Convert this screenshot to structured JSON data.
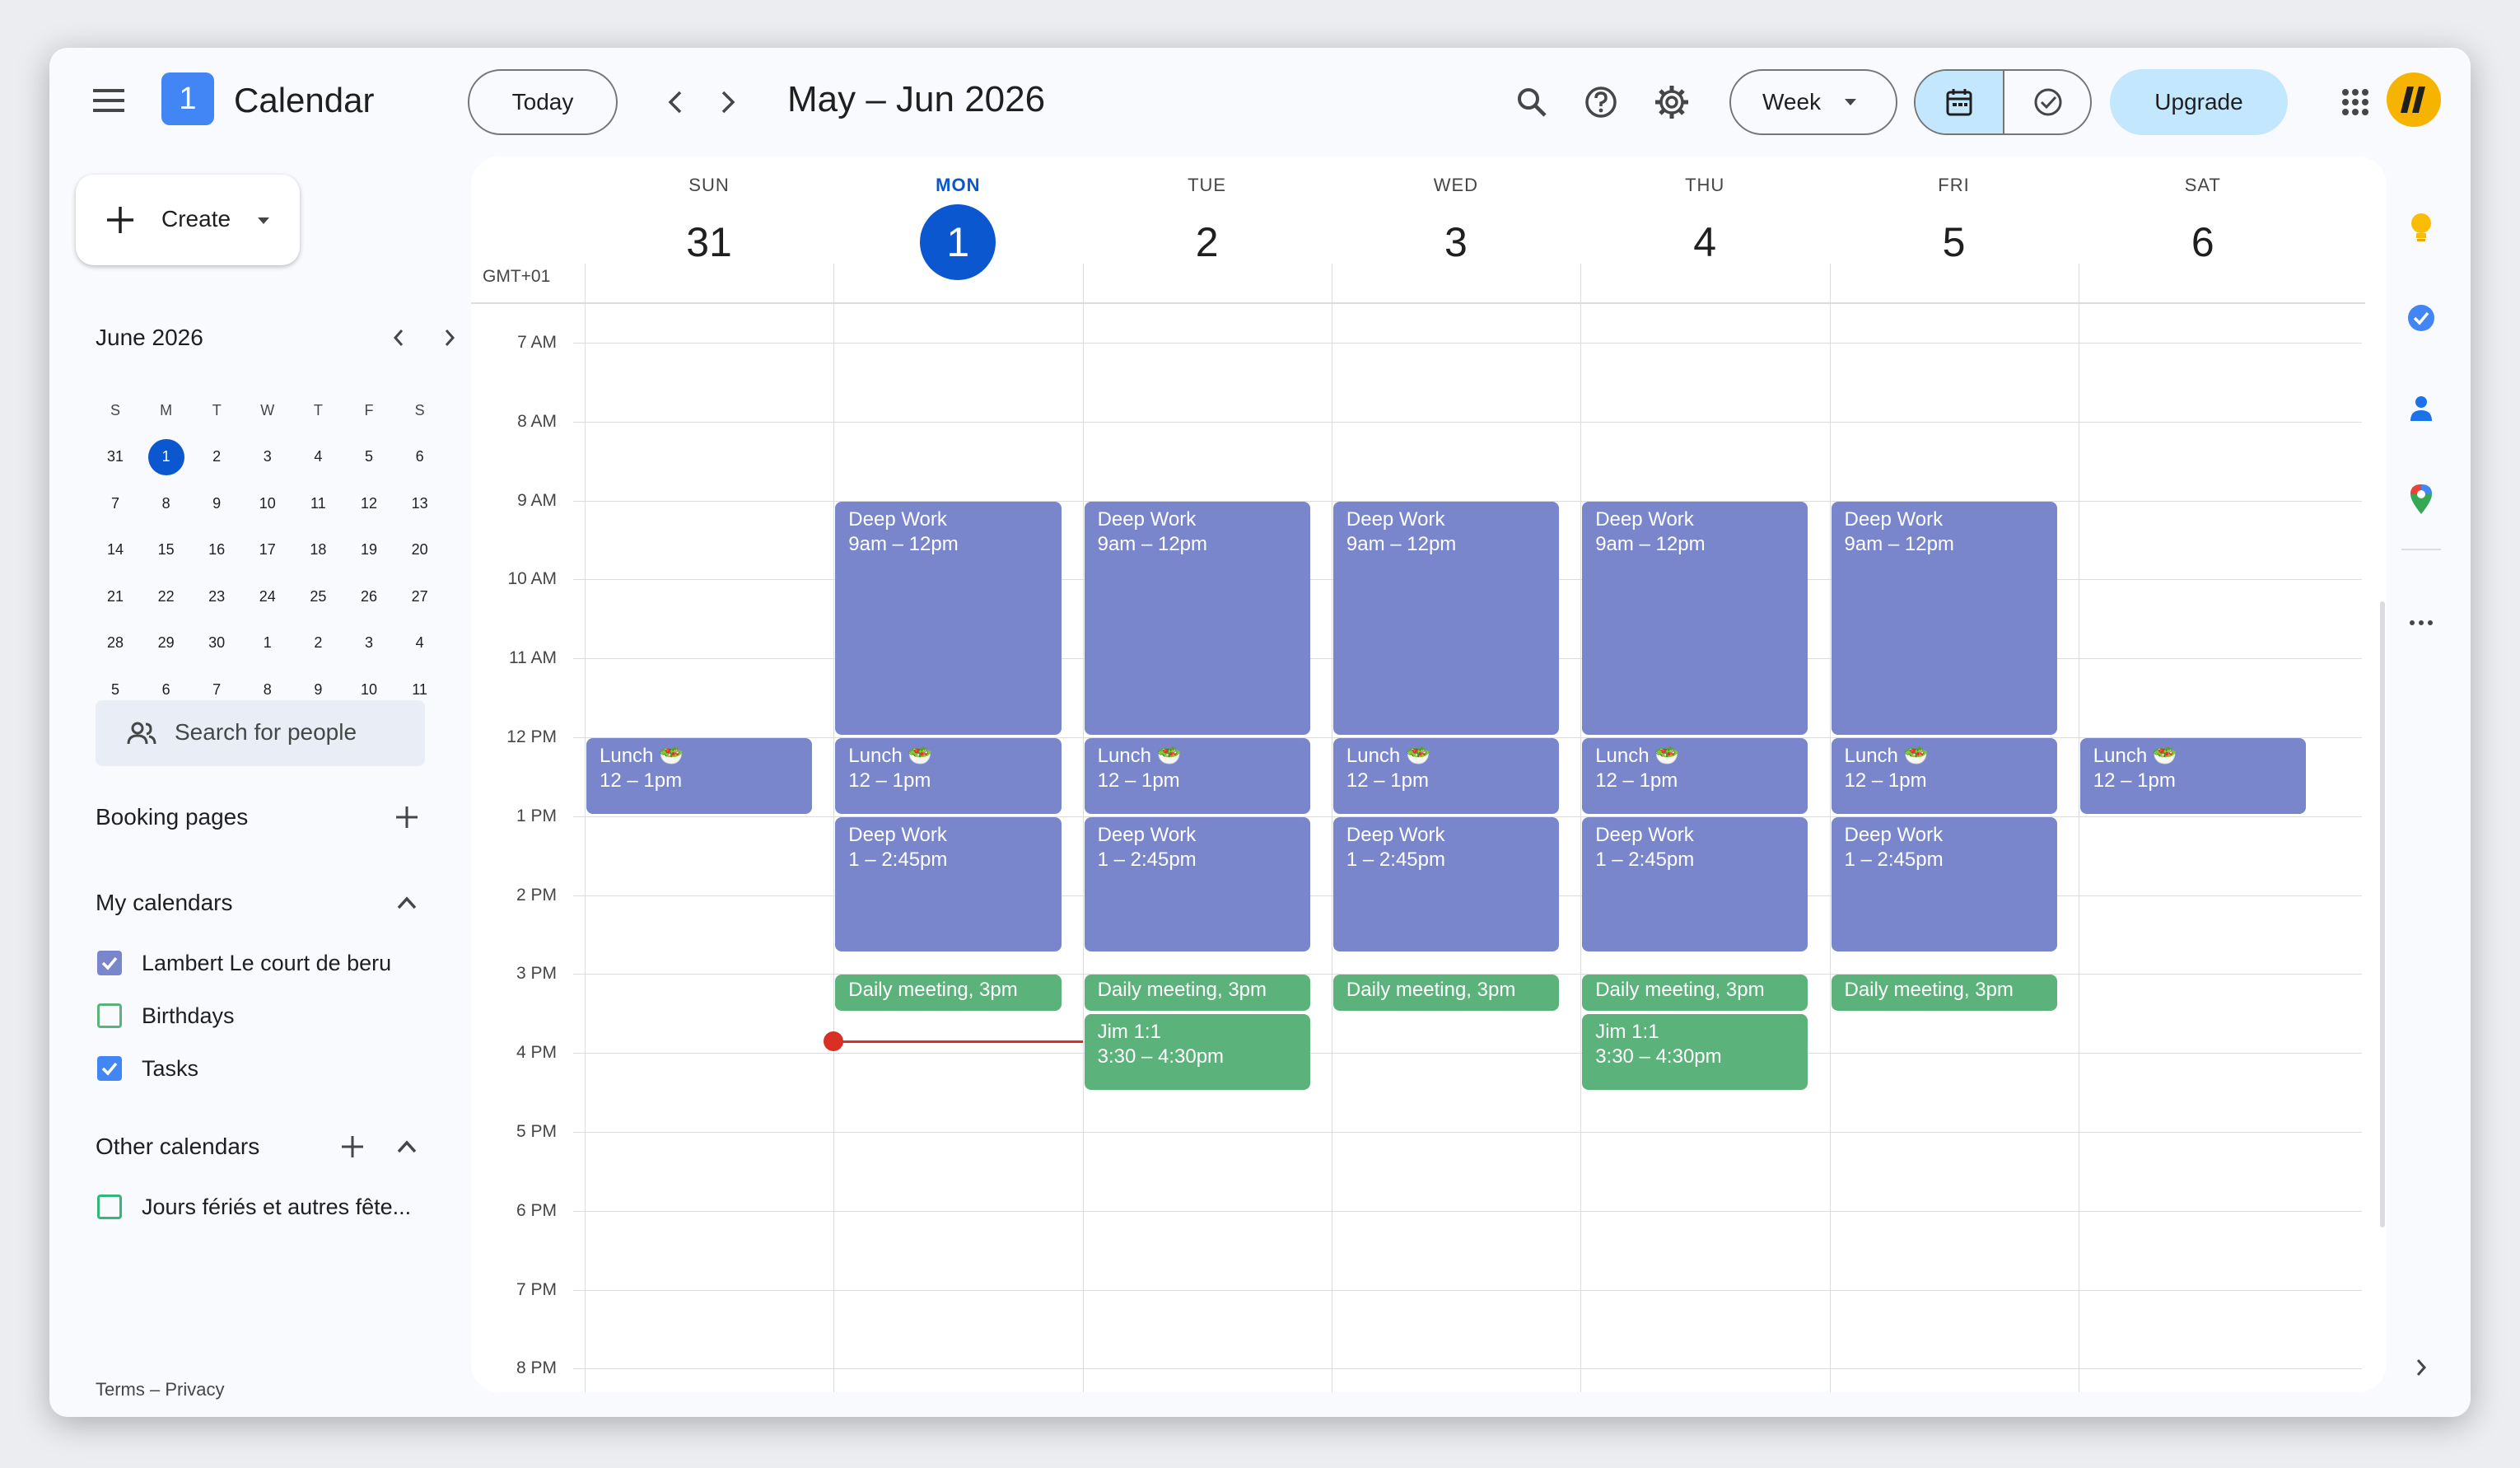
{
  "header": {
    "app_title": "Calendar",
    "logo_day": "1",
    "today_button": "Today",
    "date_range": "May – Jun 2026",
    "view_selector": "Week",
    "upgrade_button": "Upgrade"
  },
  "sidebar": {
    "create_button": "Create",
    "mini_calendar": {
      "month_label": "June 2026",
      "weekday_headers": [
        "S",
        "M",
        "T",
        "W",
        "T",
        "F",
        "S"
      ],
      "weeks": [
        [
          "31",
          "1",
          "2",
          "3",
          "4",
          "5",
          "6"
        ],
        [
          "7",
          "8",
          "9",
          "10",
          "11",
          "12",
          "13"
        ],
        [
          "14",
          "15",
          "16",
          "17",
          "18",
          "19",
          "20"
        ],
        [
          "21",
          "22",
          "23",
          "24",
          "25",
          "26",
          "27"
        ],
        [
          "28",
          "29",
          "30",
          "1",
          "2",
          "3",
          "4"
        ],
        [
          "5",
          "6",
          "7",
          "8",
          "9",
          "10",
          "11"
        ]
      ],
      "selected": "1"
    },
    "search_people_placeholder": "Search for people",
    "booking_pages_label": "Booking pages",
    "my_calendars_label": "My calendars",
    "my_calendars": [
      {
        "name": "Lambert Le court de beru",
        "checked": true,
        "color": "#7986cb"
      },
      {
        "name": "Birthdays",
        "checked": false,
        "color": "#5bb27a"
      },
      {
        "name": "Tasks",
        "checked": true,
        "color": "#4285f4"
      }
    ],
    "other_calendars_label": "Other calendars",
    "other_calendars": [
      {
        "name": "Jours fériés et autres fête...",
        "checked": false,
        "color": "#33b679"
      }
    ],
    "footer": "Terms – Privacy"
  },
  "grid": {
    "timezone": "GMT+01",
    "days": [
      {
        "name": "SUN",
        "num": "31",
        "today": false
      },
      {
        "name": "MON",
        "num": "1",
        "today": true
      },
      {
        "name": "TUE",
        "num": "2",
        "today": false
      },
      {
        "name": "WED",
        "num": "3",
        "today": false
      },
      {
        "name": "THU",
        "num": "4",
        "today": false
      },
      {
        "name": "FRI",
        "num": "5",
        "today": false
      },
      {
        "name": "SAT",
        "num": "6",
        "today": false
      }
    ],
    "hours": [
      "7 AM",
      "8 AM",
      "9 AM",
      "10 AM",
      "11 AM",
      "12 PM",
      "1 PM",
      "2 PM",
      "3 PM",
      "4 PM",
      "5 PM",
      "6 PM",
      "7 PM",
      "8 PM"
    ],
    "first_hour": 7,
    "current_time": {
      "day": 1,
      "hour": 15.85
    },
    "events": [
      {
        "day": 1,
        "start": 9,
        "end": 12,
        "title": "Deep Work",
        "time": "9am – 12pm",
        "color": "purple"
      },
      {
        "day": 2,
        "start": 9,
        "end": 12,
        "title": "Deep Work",
        "time": "9am – 12pm",
        "color": "purple"
      },
      {
        "day": 3,
        "start": 9,
        "end": 12,
        "title": "Deep Work",
        "time": "9am – 12pm",
        "color": "purple"
      },
      {
        "day": 4,
        "start": 9,
        "end": 12,
        "title": "Deep Work",
        "time": "9am – 12pm",
        "color": "purple"
      },
      {
        "day": 5,
        "start": 9,
        "end": 12,
        "title": "Deep Work",
        "time": "9am – 12pm",
        "color": "purple"
      },
      {
        "day": 0,
        "start": 12,
        "end": 13,
        "title": "Lunch 🥗",
        "time": "12 – 1pm",
        "color": "purple"
      },
      {
        "day": 1,
        "start": 12,
        "end": 13,
        "title": "Lunch 🥗",
        "time": "12 – 1pm",
        "color": "purple"
      },
      {
        "day": 2,
        "start": 12,
        "end": 13,
        "title": "Lunch 🥗",
        "time": "12 – 1pm",
        "color": "purple"
      },
      {
        "day": 3,
        "start": 12,
        "end": 13,
        "title": "Lunch 🥗",
        "time": "12 – 1pm",
        "color": "purple"
      },
      {
        "day": 4,
        "start": 12,
        "end": 13,
        "title": "Lunch 🥗",
        "time": "12 – 1pm",
        "color": "purple"
      },
      {
        "day": 5,
        "start": 12,
        "end": 13,
        "title": "Lunch 🥗",
        "time": "12 – 1pm",
        "color": "purple"
      },
      {
        "day": 6,
        "start": 12,
        "end": 13,
        "title": "Lunch 🥗",
        "time": "12 – 1pm",
        "color": "purple"
      },
      {
        "day": 1,
        "start": 13,
        "end": 14.75,
        "title": "Deep Work",
        "time": "1 – 2:45pm",
        "color": "purple"
      },
      {
        "day": 2,
        "start": 13,
        "end": 14.75,
        "title": "Deep Work",
        "time": "1 – 2:45pm",
        "color": "purple"
      },
      {
        "day": 3,
        "start": 13,
        "end": 14.75,
        "title": "Deep Work",
        "time": "1 – 2:45pm",
        "color": "purple"
      },
      {
        "day": 4,
        "start": 13,
        "end": 14.75,
        "title": "Deep Work",
        "time": "1 – 2:45pm",
        "color": "purple"
      },
      {
        "day": 5,
        "start": 13,
        "end": 14.75,
        "title": "Deep Work",
        "time": "1 – 2:45pm",
        "color": "purple"
      },
      {
        "day": 1,
        "start": 15,
        "end": 15.5,
        "title": "Daily meeting, 3pm",
        "time": "",
        "color": "green"
      },
      {
        "day": 2,
        "start": 15,
        "end": 15.5,
        "title": "Daily meeting, 3pm",
        "time": "",
        "color": "green"
      },
      {
        "day": 3,
        "start": 15,
        "end": 15.5,
        "title": "Daily meeting, 3pm",
        "time": "",
        "color": "green"
      },
      {
        "day": 4,
        "start": 15,
        "end": 15.5,
        "title": "Daily meeting, 3pm",
        "time": "",
        "color": "green"
      },
      {
        "day": 5,
        "start": 15,
        "end": 15.5,
        "title": "Daily meeting, 3pm",
        "time": "",
        "color": "green"
      },
      {
        "day": 2,
        "start": 15.5,
        "end": 16.5,
        "title": "Jim 1:1",
        "time": "3:30 – 4:30pm",
        "color": "green"
      },
      {
        "day": 4,
        "start": 15.5,
        "end": 16.5,
        "title": "Jim 1:1",
        "time": "3:30 – 4:30pm",
        "color": "green"
      }
    ]
  },
  "colors": {
    "accent": "#0b57d0",
    "event_purple": "#7986cb",
    "event_green": "#5bb27a",
    "now_line": "#d93025",
    "upgrade_bg": "#c2e7ff"
  }
}
